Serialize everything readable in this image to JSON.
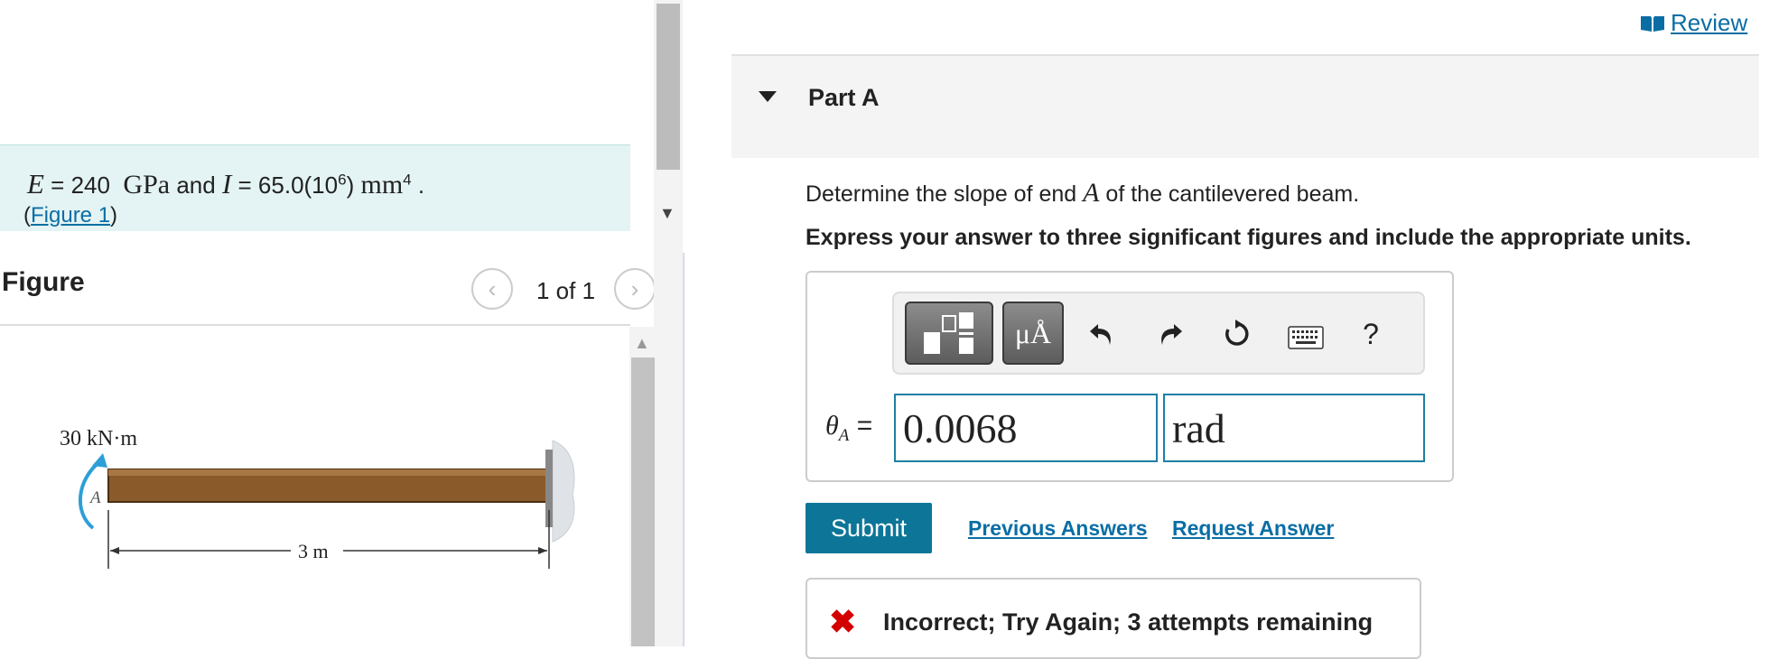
{
  "problem": {
    "given": {
      "e_symbol": "E",
      "e_value": "240",
      "e_unit": "GPa",
      "and_text": "and",
      "i_symbol": "I",
      "i_value": "65.0(10",
      "i_exp": "6",
      "i_close": ")",
      "i_unit": "mm",
      "i_unit_exp": "4",
      "period": "."
    },
    "figure_link": "Figure 1"
  },
  "figure_panel": {
    "title": "Figure",
    "count": "1 of 1",
    "prev_icon": "chevron-left-icon",
    "next_icon": "chevron-right-icon",
    "diagram": {
      "moment_label": "30 kN·m",
      "end_label": "A",
      "length_label": "3 m",
      "beam_color": "#8a5a2b"
    }
  },
  "header": {
    "review_label": "Review",
    "review_icon": "book-icon"
  },
  "part": {
    "title": "Part A",
    "question_before": "Determine the slope of end",
    "question_var": "A",
    "question_after": "of the cantilevered beam.",
    "instruction": "Express your answer to three significant figures and include the appropriate units."
  },
  "toolbar": {
    "units_label": "μÅ",
    "undo_icon": "undo-icon",
    "redo_icon": "redo-icon",
    "reset_icon": "reset-icon",
    "keyboard_icon": "keyboard-icon",
    "help_label": "?"
  },
  "answer": {
    "theta_symbol": "θ",
    "theta_sub": "A",
    "equals": "=",
    "value": "0.0068",
    "unit": "rad"
  },
  "actions": {
    "submit_label": "Submit",
    "previous_answers_label": "Previous Answers",
    "request_answer_label": "Request Answer"
  },
  "feedback": {
    "icon": "x-icon",
    "text": "Incorrect; Try Again; 3 attempts remaining",
    "color": "#d40000"
  },
  "colors": {
    "accent": "#0d7698",
    "link": "#0a6ea4",
    "given_bg": "#e4f3f3"
  }
}
